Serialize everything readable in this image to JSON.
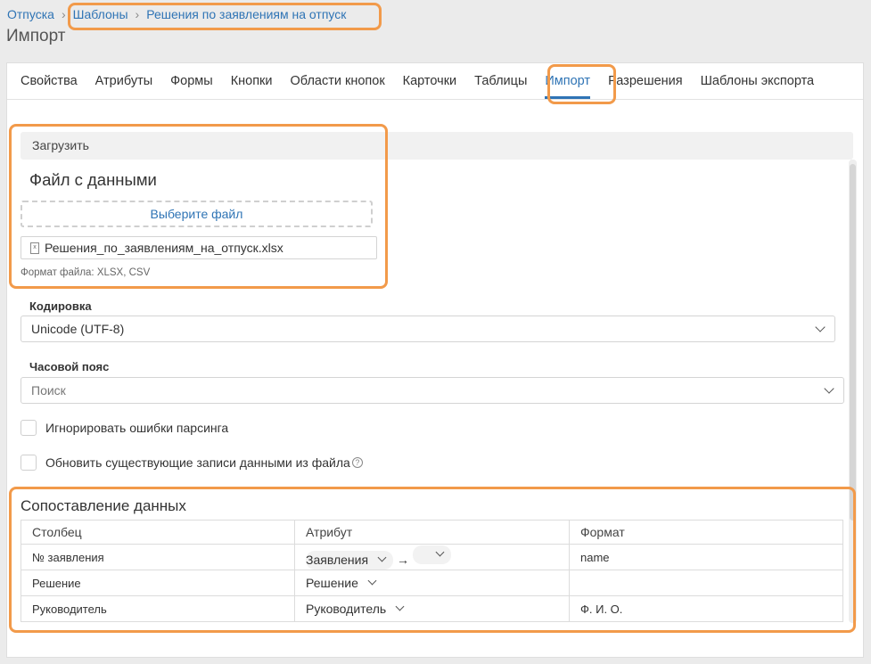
{
  "breadcrumb": {
    "items": [
      "Отпуска",
      "Шаблоны",
      "Решения по заявлениям на отпуск"
    ]
  },
  "page_title": "Импорт",
  "tabs": [
    {
      "label": "Свойства",
      "active": false
    },
    {
      "label": "Атрибуты",
      "active": false
    },
    {
      "label": "Формы",
      "active": false
    },
    {
      "label": "Кнопки",
      "active": false
    },
    {
      "label": "Области кнопок",
      "active": false
    },
    {
      "label": "Карточки",
      "active": false
    },
    {
      "label": "Таблицы",
      "active": false
    },
    {
      "label": "Импорт",
      "active": true
    },
    {
      "label": "Разрешения",
      "active": false
    },
    {
      "label": "Шаблоны экспорта",
      "active": false
    }
  ],
  "upload": {
    "panel_label": "Загрузить",
    "title": "Файл с данными",
    "choose_label": "Выберите файл",
    "file_name": "Решения_по_заявлениям_на_отпуск.xlsx",
    "format_hint": "Формат файла: XLSX, CSV"
  },
  "encoding": {
    "label": "Кодировка",
    "value": "Unicode (UTF-8)"
  },
  "timezone": {
    "label": "Часовой пояс",
    "placeholder": "Поиск"
  },
  "options": {
    "ignore_errors": {
      "label": "Игнорировать ошибки парсинга",
      "checked": false
    },
    "update_existing": {
      "label": "Обновить существующие записи данными из файла",
      "checked": false
    }
  },
  "mapping": {
    "title": "Сопоставление данных",
    "headers": [
      "Столбец",
      "Атрибут",
      "Формат"
    ],
    "rows": [
      {
        "column": "№ заявления",
        "attribute": "Заявления",
        "format": "name"
      },
      {
        "column": "Решение",
        "attribute": "Решение",
        "format": ""
      },
      {
        "column": "Руководитель",
        "attribute": "Руководитель",
        "format": "Ф. И. О."
      }
    ]
  },
  "colors": {
    "accent": "#2f74b5",
    "highlight": "#f29a4a"
  },
  "icons": [
    "chevron-right-icon",
    "excel-file-icon",
    "chevron-down-icon",
    "help-icon",
    "arrow-right-icon"
  ]
}
